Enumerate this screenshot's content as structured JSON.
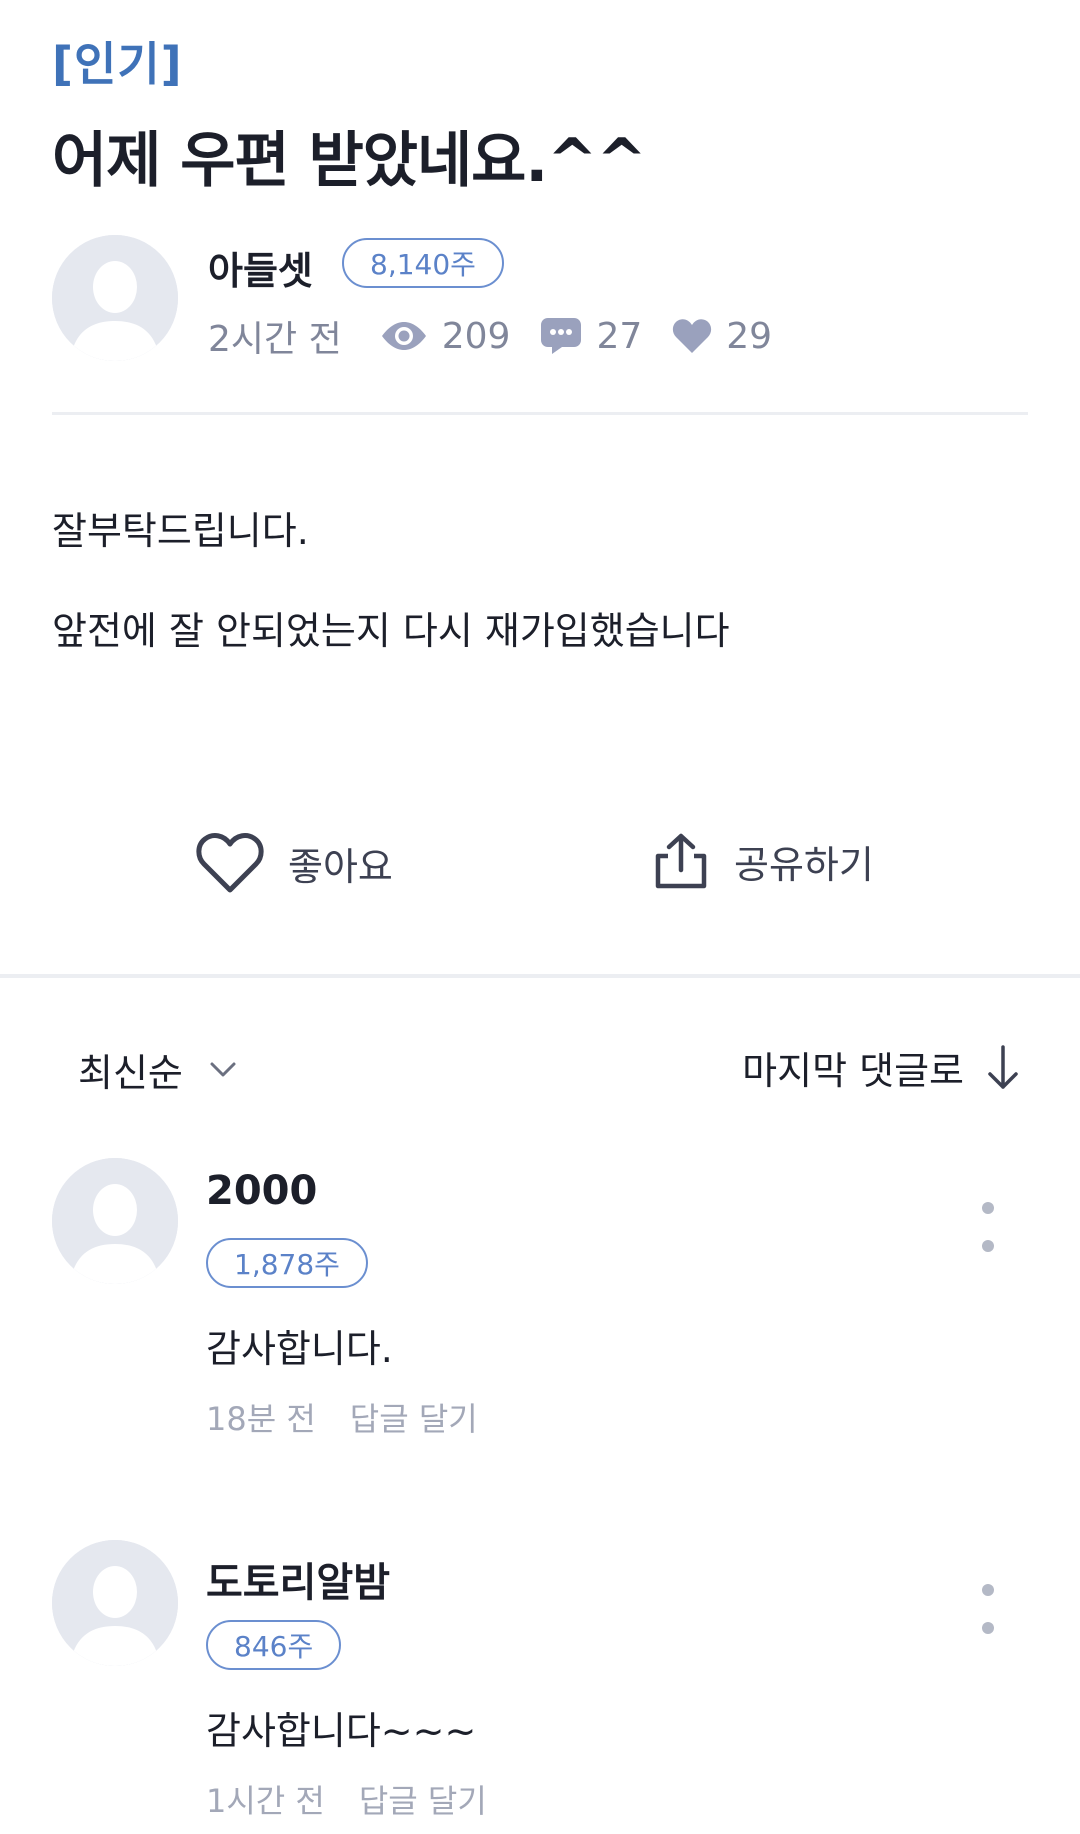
{
  "post": {
    "tag": "[인기]",
    "title": "어제 우편 받았네요.^^",
    "author": {
      "name": "아들셋",
      "badge": "8,140주",
      "avatar_icon": "default-user-icon"
    },
    "meta": {
      "time": "2시간 전",
      "views": "209",
      "comments": "27",
      "likes": "29"
    },
    "body": [
      "잘부탁드립니다.",
      "앞전에 잘 안되었는지 다시 재가입했습니다"
    ]
  },
  "actions": {
    "like_label": "좋아요",
    "share_label": "공유하기"
  },
  "comments_bar": {
    "sort_label": "최신순",
    "jump_label": "마지막 댓글로"
  },
  "comments": [
    {
      "name": "2000",
      "badge": "1,878주",
      "text": "감사합니다.",
      "time": "18분 전",
      "reply_label": "답글 달기"
    },
    {
      "name": "도토리알밤",
      "badge": "846주",
      "text": "감사합니다~~~",
      "time": "1시간 전",
      "reply_label": "답글 달기"
    }
  ],
  "colors": {
    "tag": "#3f72b8",
    "badge": "#5b82c8",
    "meta": "#80869a",
    "icon": "#9aa1bd",
    "divider": "#eceef2"
  }
}
